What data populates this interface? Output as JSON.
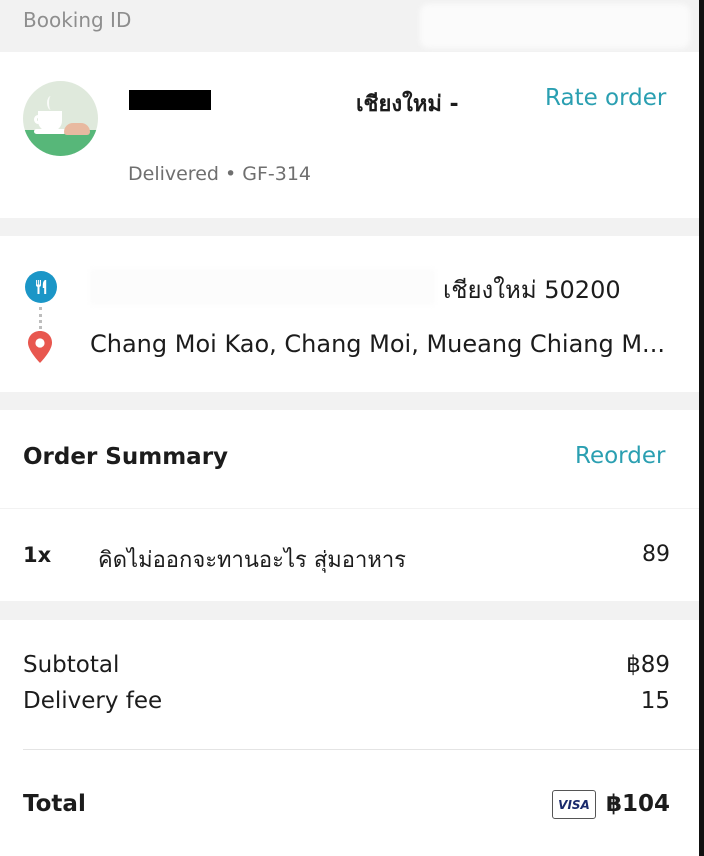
{
  "header": {
    "booking_label": "Booking ID"
  },
  "merchant": {
    "city_label": "เชียงใหม่ -",
    "rate_label": "Rate order",
    "status_line": "Delivered • GF-314"
  },
  "route": {
    "pickup_text": "เชียงใหม่ 50200",
    "dropoff_text": "Chang Moi Kao, Chang Moi, Mueang Chiang M...",
    "pickup_icon": "utensils-icon",
    "dropoff_icon": "location-pin-icon",
    "colors": {
      "pickup": "#1b96c7",
      "dropoff": "#e8574f"
    }
  },
  "summary": {
    "title": "Order Summary",
    "reorder_label": "Reorder",
    "items": [
      {
        "qty": "1x",
        "name": "คิดไม่ออกจะทานอะไร สุ่มอาหาร",
        "price": "89"
      }
    ]
  },
  "totals": {
    "subtotal_label": "Subtotal",
    "subtotal_value": "฿89",
    "delivery_label": "Delivery fee",
    "delivery_value": "15",
    "total_label": "Total",
    "payment_badge": "VISA",
    "total_value": "฿104"
  },
  "colors": {
    "accent": "#2a9fb1",
    "background": "#f2f2f2"
  }
}
